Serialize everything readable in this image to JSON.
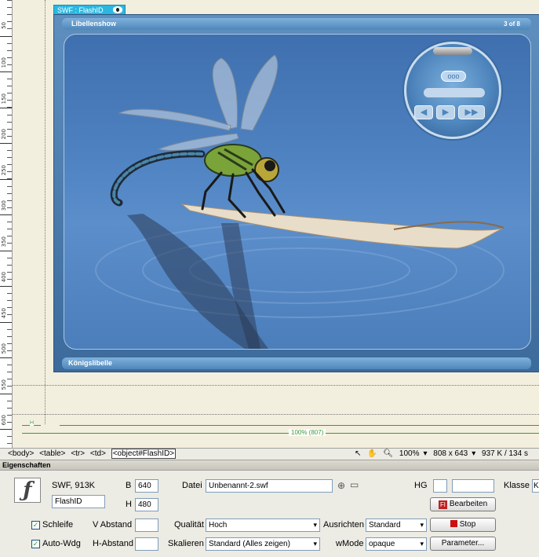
{
  "canvas": {
    "swf_tab_label": "SWF : FlashID",
    "width_label": "100% (807)",
    "height_marker": "H",
    "ruler_numbers": [
      "50",
      "100",
      "150",
      "200",
      "250",
      "300",
      "350",
      "400",
      "450",
      "500",
      "550",
      "600"
    ]
  },
  "movie": {
    "title": "Libellenshow",
    "counter": "3 of 8",
    "caption": "Königslibelle",
    "player_dots": "ooo",
    "buttons": [
      "◀",
      "▶",
      "▶▶"
    ]
  },
  "statusbar": {
    "tags": [
      "<body>",
      "<table>",
      "<tr>",
      "<td>"
    ],
    "current_tag": "<object#FlashID>",
    "zoom": "100%",
    "dimensions": "808 x 643",
    "size_time": "937 K / 134 s"
  },
  "properties": {
    "header": "Eigenschaften",
    "type_info": "SWF, 913K",
    "id_value": "FlashID",
    "b_label": "B",
    "b_value": "640",
    "h_label": "H",
    "h_value": "480",
    "file_label": "Datei",
    "file_value": "Unbenannt-2.swf",
    "bg_label": "HG",
    "class_label": "Klasse",
    "class_value": "K",
    "edit_button": "Bearbeiten",
    "loop_label": "Schleife",
    "autoplay_label": "Auto-Wdg",
    "vspace_label": "V Abstand",
    "hspace_label": "H-Abstand",
    "quality_label": "Qualität",
    "quality_value": "Hoch",
    "scale_label": "Skalieren",
    "scale_value": "Standard (Alles zeigen)",
    "align_label": "Ausrichten",
    "align_value": "Standard",
    "wmode_label": "wMode",
    "wmode_value": "opaque",
    "stop_button": "Stop",
    "params_button": "Parameter..."
  },
  "colors": {
    "canvas_bg": "#f3efde",
    "swf_tab": "#2ab8e2",
    "guide_green": "#3a9a3a",
    "movie_blue": "#4f86ba"
  }
}
